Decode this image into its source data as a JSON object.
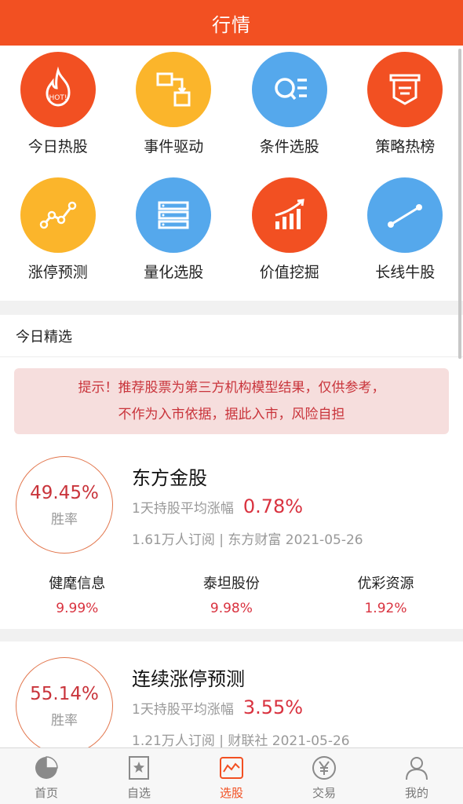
{
  "header": {
    "title": "行情"
  },
  "grid": [
    {
      "label": "今日热股",
      "icon": "fire-hot-icon"
    },
    {
      "label": "事件驱动",
      "icon": "event-flow-icon"
    },
    {
      "label": "条件选股",
      "icon": "search-list-icon"
    },
    {
      "label": "策略热榜",
      "icon": "ribbon-badge-icon"
    },
    {
      "label": "涨停预测",
      "icon": "trend-line-icon"
    },
    {
      "label": "量化选股",
      "icon": "stack-list-icon"
    },
    {
      "label": "价值挖掘",
      "icon": "bar-growth-icon"
    },
    {
      "label": "长线牛股",
      "icon": "long-line-icon"
    }
  ],
  "hot_badge": "HOT!",
  "section": {
    "title": "今日精选"
  },
  "tip": {
    "line1": "提示！推荐股票为第三方机构模型结果，仅供参考，",
    "line2": "不作为入市依据，据此入市，风险自担"
  },
  "cards": [
    {
      "rate": "49.45%",
      "rate_label": "胜率",
      "title": "东方金股",
      "avg_label": "1天持股平均涨幅",
      "avg_value": "0.78%",
      "meta": "1.61万人订阅 | 东方财富 2021-05-26",
      "stocks": [
        {
          "name": "健麾信息",
          "value": "9.99%"
        },
        {
          "name": "泰坦股份",
          "value": "9.98%"
        },
        {
          "name": "优彩资源",
          "value": "1.92%"
        }
      ]
    },
    {
      "rate": "55.14%",
      "rate_label": "胜率",
      "title": "连续涨停预测",
      "avg_label": "1天持股平均涨幅",
      "avg_value": "3.55%",
      "meta": "1.21万人订阅 | 财联社 2021-05-26"
    }
  ],
  "tabs": [
    {
      "label": "首页",
      "icon": "pie-chart-icon"
    },
    {
      "label": "自选",
      "icon": "star-bookmark-icon"
    },
    {
      "label": "选股",
      "icon": "stock-chart-icon"
    },
    {
      "label": "交易",
      "icon": "yen-coin-icon"
    },
    {
      "label": "我的",
      "icon": "user-icon"
    }
  ],
  "colors": {
    "brand": "#f25022",
    "up": "#d9323f",
    "yellow": "#fbb52b",
    "blue": "#55a8ec"
  }
}
